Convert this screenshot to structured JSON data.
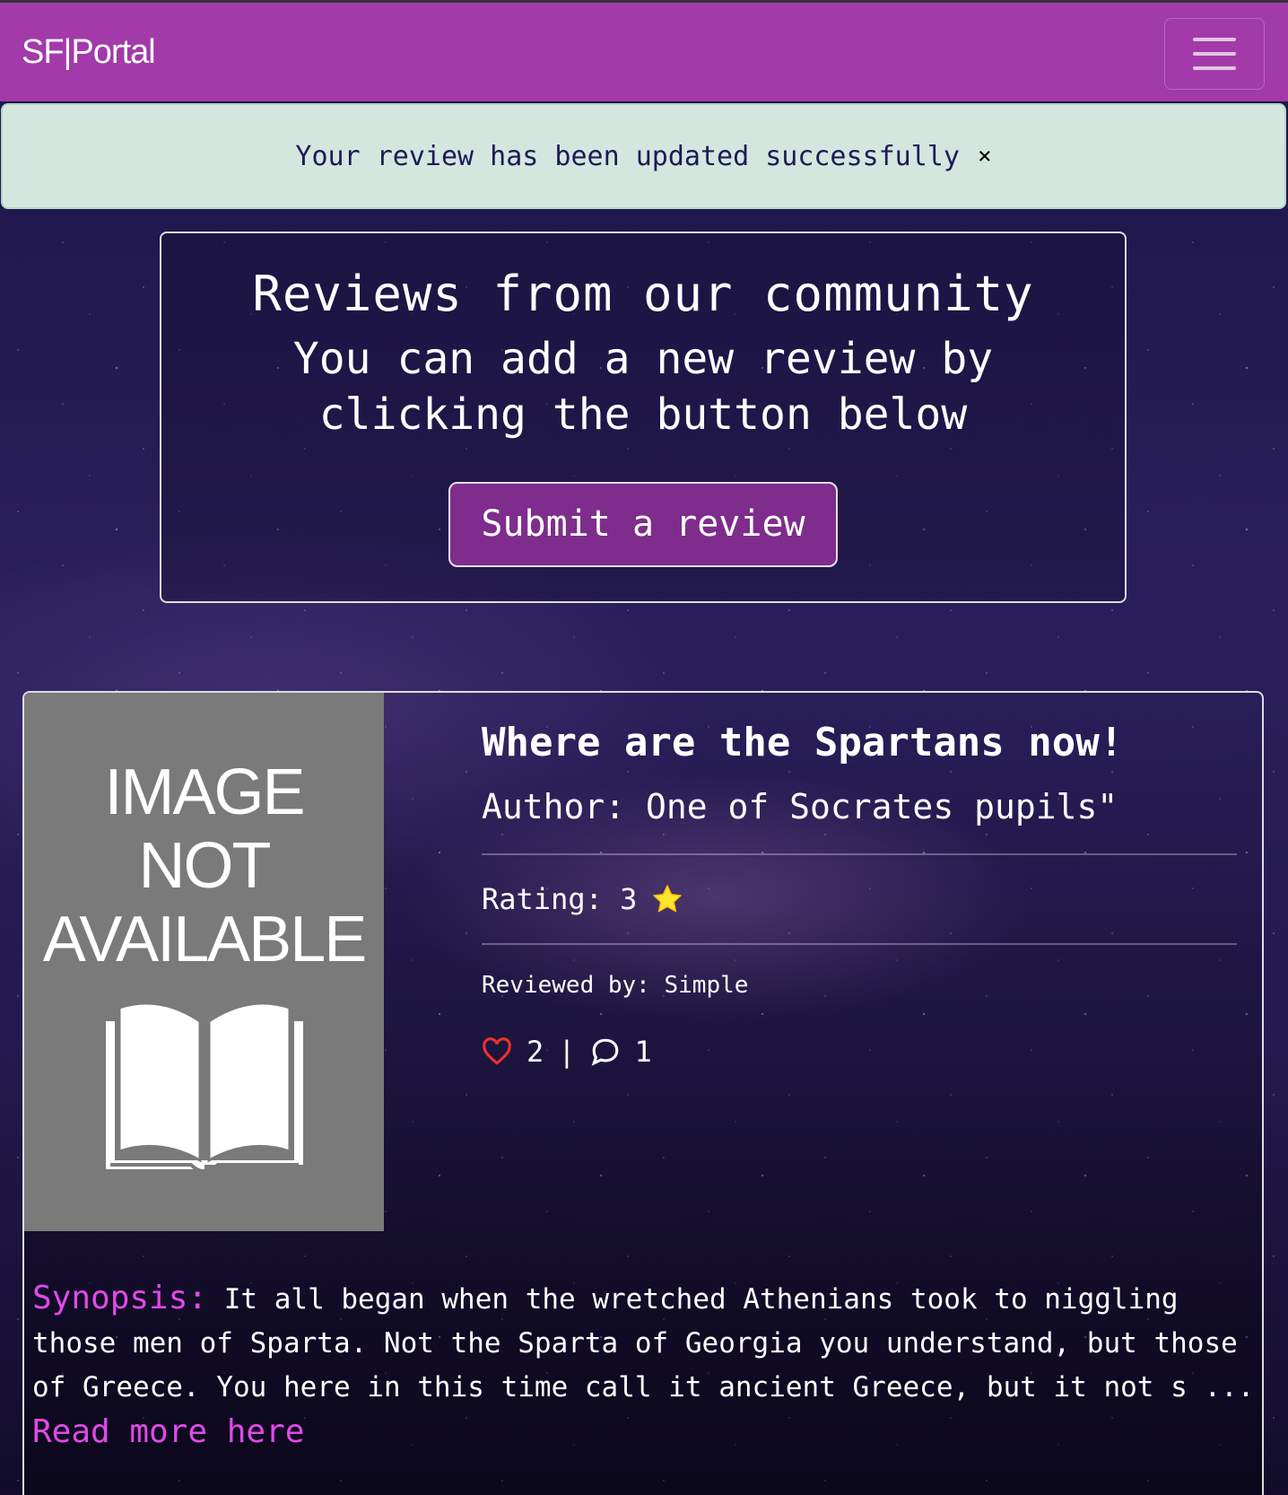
{
  "navbar": {
    "brand": "SF|Portal",
    "menu_icon": "hamburger-icon",
    "color": "#a23aa9"
  },
  "alert": {
    "message": "Your review has been updated successfully",
    "close": "×"
  },
  "hero": {
    "title": "Reviews from our community",
    "subtitle": "You can add a new review by clicking the button below",
    "button": "Submit a review"
  },
  "review": {
    "image_text_lines": [
      "IMAGE",
      "NOT",
      "AVAILABLE"
    ],
    "title": "Where are the Spartans now!",
    "author": "Author: One of Socrates pupils\"",
    "rating_label": "Rating: 3",
    "rating": 3,
    "reviewed_by": "Reviewed by: Simple",
    "likes": "2",
    "separator": "|",
    "comments": "1",
    "synopsis_label": "Synopsis:",
    "synopsis": "It all began when the wretched Athenians took to niggling those men of Sparta. Not the Sparta of Georgia you understand, but those of Greece. You here in this time call it ancient Greece, but it not s ...",
    "read_more": "Read more here"
  }
}
